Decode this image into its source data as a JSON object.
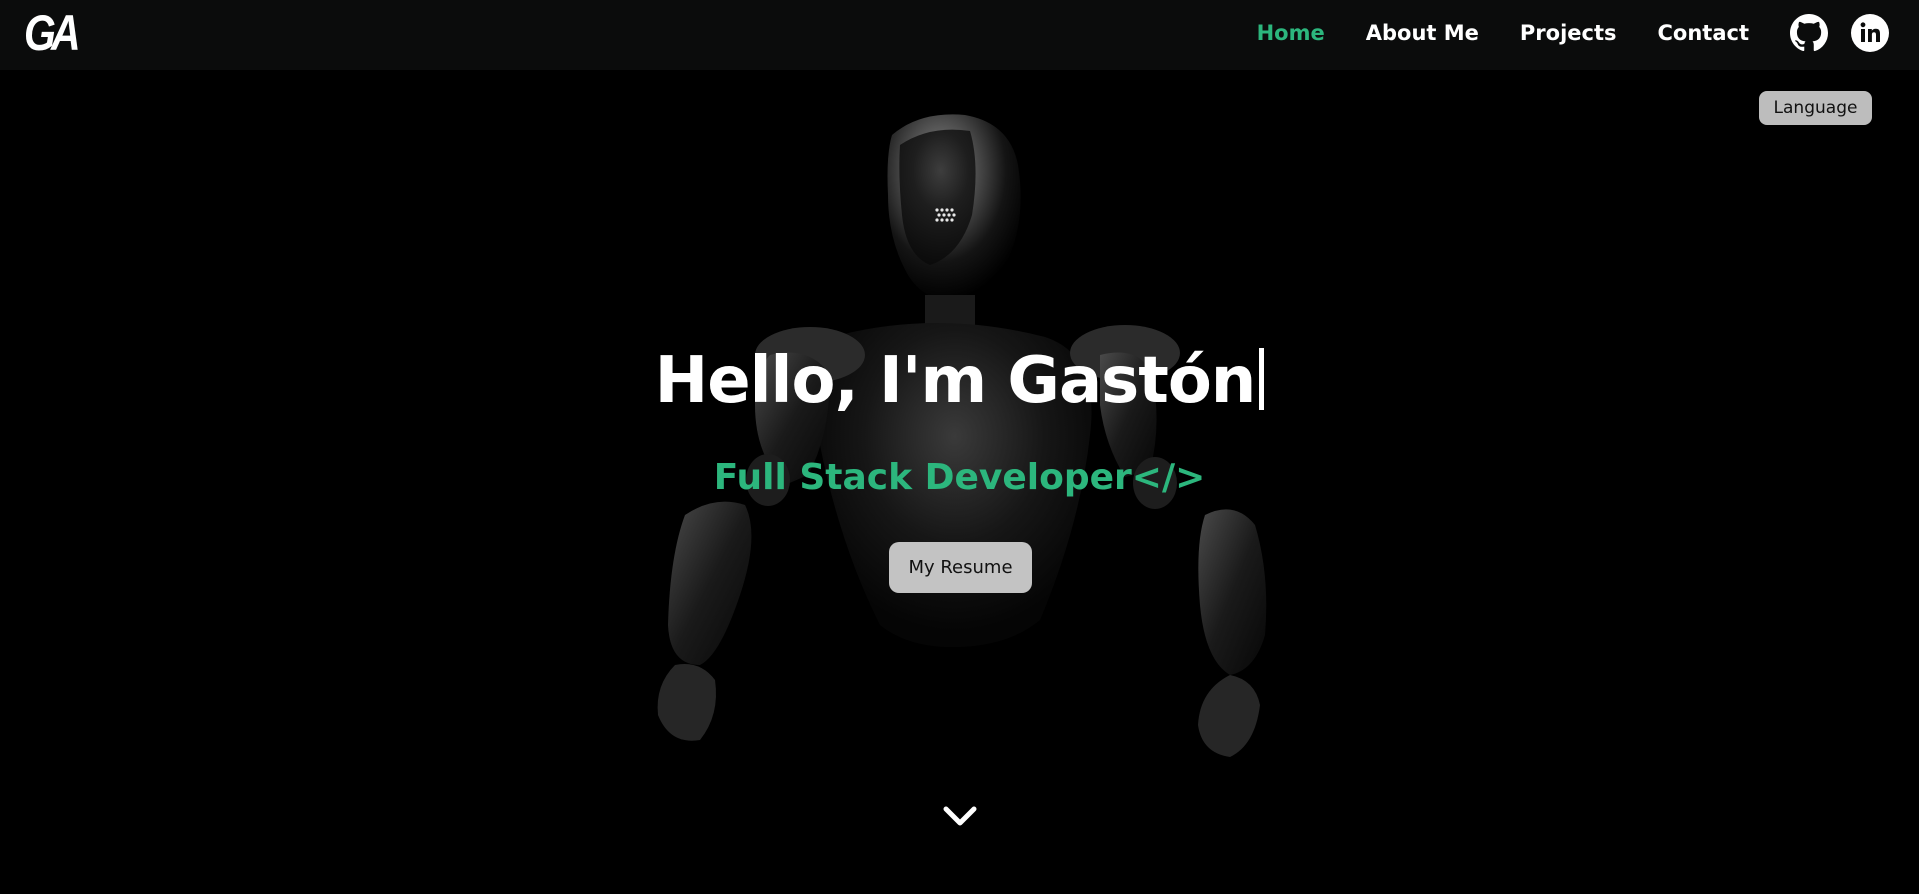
{
  "brand": {
    "logo_text": "GA"
  },
  "nav": {
    "items": [
      {
        "label": "Home",
        "active": true
      },
      {
        "label": "About Me",
        "active": false
      },
      {
        "label": "Projects",
        "active": false
      },
      {
        "label": "Contact",
        "active": false
      }
    ],
    "social": [
      {
        "icon": "github-icon"
      },
      {
        "icon": "linkedin-icon"
      }
    ]
  },
  "language_button": {
    "label": "Language"
  },
  "hero": {
    "title": "Hello, I'm Gastón",
    "subtitle": "Full Stack Developer</>",
    "resume_button": "My Resume",
    "background_image": "robot-figure",
    "scroll_icon": "chevron-down-icon"
  },
  "colors": {
    "background": "#000000",
    "navbar": "#0b0c0c",
    "accent": "#2cb67d",
    "button": "#c3c3c3",
    "text": "#ffffff"
  }
}
